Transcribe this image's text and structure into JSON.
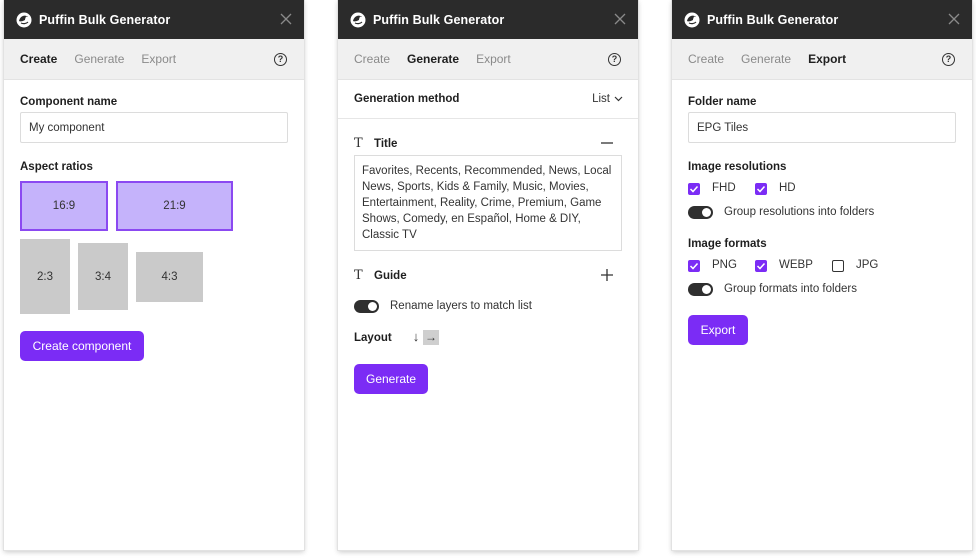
{
  "app": {
    "title": "Puffin Bulk Generator"
  },
  "tabs": [
    "Create",
    "Generate",
    "Export"
  ],
  "help_label": "?",
  "colors": {
    "accent": "#7b2cf5",
    "titlebar": "#2b2b2b",
    "ratio_selected": "#c5b3fb",
    "ratio_plain": "#cacaca"
  },
  "icons": {
    "logo": "puffin-logo-icon",
    "close": "close-icon",
    "help": "help-icon"
  },
  "create": {
    "component_name_label": "Component name",
    "component_name_value": "My component",
    "aspect_ratios_label": "Aspect ratios",
    "ratios": [
      {
        "label": "16:9",
        "selected": true
      },
      {
        "label": "21:9",
        "selected": true
      },
      {
        "label": "2:3",
        "selected": false
      },
      {
        "label": "3:4",
        "selected": false
      },
      {
        "label": "4:3",
        "selected": false
      }
    ],
    "create_button": "Create component"
  },
  "generate": {
    "method_label": "Generation method",
    "method_value": "List",
    "title_section": "Title",
    "title_list": "Favorites, Recents, Recommended, News, Local News, Sports, Kids & Family, Music, Movies, Entertainment, Reality, Crime, Premium, Game Shows, Comedy, en Español, Home & DIY, Classic TV",
    "guide_section": "Guide",
    "rename_layers_label": "Rename layers to match list",
    "rename_layers_on": true,
    "layout_label": "Layout",
    "layout_vertical": "↓",
    "layout_horizontal": "→",
    "layout_selected": "horizontal",
    "generate_button": "Generate"
  },
  "export": {
    "folder_name_label": "Folder name",
    "folder_name_value": "EPG Tiles",
    "resolutions_label": "Image resolutions",
    "resolutions": [
      {
        "label": "FHD",
        "checked": true
      },
      {
        "label": "HD",
        "checked": true
      }
    ],
    "group_resolutions_label": "Group resolutions into folders",
    "group_resolutions_on": true,
    "formats_label": "Image formats",
    "formats": [
      {
        "label": "PNG",
        "checked": true
      },
      {
        "label": "WEBP",
        "checked": true
      },
      {
        "label": "JPG",
        "checked": false
      }
    ],
    "group_formats_label": "Group formats into folders",
    "group_formats_on": true,
    "export_button": "Export"
  }
}
